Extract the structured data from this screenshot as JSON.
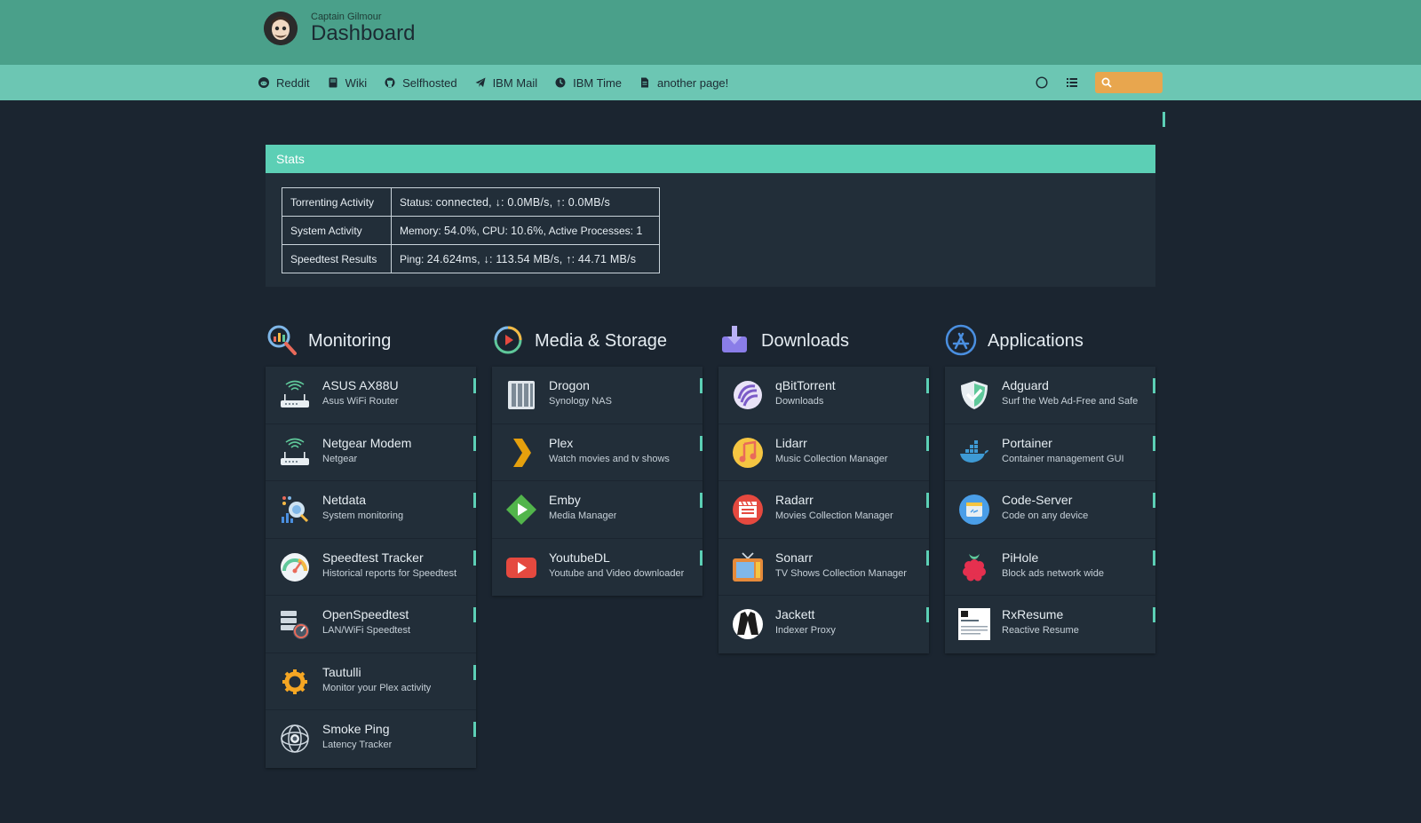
{
  "header": {
    "subtitle": "Captain Gilmour",
    "title": "Dashboard"
  },
  "nav": {
    "links": [
      {
        "label": "Reddit",
        "icon": "reddit-icon"
      },
      {
        "label": "Wiki",
        "icon": "book-icon"
      },
      {
        "label": "Selfhosted",
        "icon": "github-icon"
      },
      {
        "label": "IBM Mail",
        "icon": "paper-plane-icon"
      },
      {
        "label": "IBM Time",
        "icon": "clock-icon"
      },
      {
        "label": "another page!",
        "icon": "file-icon"
      }
    ],
    "search_value": ""
  },
  "stats": {
    "heading": "Stats",
    "rows": [
      {
        "label": "Torrenting Activity",
        "prefix": "Status: ",
        "value": "connected, ↓: 0.0MB/s, ↑: 0.0MB/s",
        "pre2": "",
        "v2": ""
      },
      {
        "label": "System Activity",
        "prefix": "Memory: ",
        "value": "54.0%",
        "pre2": ", CPU: ",
        "v2": "10.6%",
        "pre3": ", Active Processes: ",
        "v3": "1"
      },
      {
        "label": "Speedtest Results",
        "prefix": "Ping: ",
        "value": "24.624ms, ↓: 113.54 MB/s, ↑: 44.71 MB/s"
      }
    ]
  },
  "groups": [
    {
      "title": "Monitoring",
      "icon": "magnifier-chart-icon",
      "items": [
        {
          "name": "ASUS AX88U",
          "desc": "Asus WiFi Router",
          "icon": "router-icon"
        },
        {
          "name": "Netgear Modem",
          "desc": "Netgear",
          "icon": "router-icon"
        },
        {
          "name": "Netdata",
          "desc": "System monitoring",
          "icon": "netdata-icon"
        },
        {
          "name": "Speedtest Tracker",
          "desc": "Historical reports for Speedtest",
          "icon": "gauge-icon"
        },
        {
          "name": "OpenSpeedtest",
          "desc": "LAN/WiFi Speedtest",
          "icon": "server-gauge-icon"
        },
        {
          "name": "Tautulli",
          "desc": "Monitor your Plex activity",
          "icon": "gear-icon"
        },
        {
          "name": "Smoke Ping",
          "desc": "Latency Tracker",
          "icon": "radar-icon"
        }
      ]
    },
    {
      "title": "Media & Storage",
      "icon": "play-ring-icon",
      "items": [
        {
          "name": "Drogon",
          "desc": "Synology NAS",
          "icon": "nas-icon"
        },
        {
          "name": "Plex",
          "desc": "Watch movies and tv shows",
          "icon": "plex-chevron-icon"
        },
        {
          "name": "Emby",
          "desc": "Media Manager",
          "icon": "emby-icon"
        },
        {
          "name": "YoutubeDL",
          "desc": "Youtube and Video downloader",
          "icon": "youtube-icon"
        }
      ]
    },
    {
      "title": "Downloads",
      "icon": "download-tray-icon",
      "items": [
        {
          "name": "qBitTorrent",
          "desc": "Downloads",
          "icon": "qbittorrent-icon"
        },
        {
          "name": "Lidarr",
          "desc": "Music Collection Manager",
          "icon": "music-note-icon"
        },
        {
          "name": "Radarr",
          "desc": "Movies Collection Manager",
          "icon": "clapperboard-icon"
        },
        {
          "name": "Sonarr",
          "desc": "TV Shows Collection Manager",
          "icon": "tv-icon"
        },
        {
          "name": "Jackett",
          "desc": "Indexer Proxy",
          "icon": "jacket-icon"
        }
      ]
    },
    {
      "title": "Applications",
      "icon": "app-store-icon",
      "items": [
        {
          "name": "Adguard",
          "desc": "Surf the Web Ad-Free and Safe",
          "icon": "shield-check-icon"
        },
        {
          "name": "Portainer",
          "desc": "Container management GUI",
          "icon": "docker-whale-icon"
        },
        {
          "name": "Code-Server",
          "desc": "Code on any device",
          "icon": "code-server-icon"
        },
        {
          "name": "PiHole",
          "desc": "Block ads network wide",
          "icon": "raspberry-icon"
        },
        {
          "name": "RxResume",
          "desc": "Reactive Resume",
          "icon": "resume-icon"
        }
      ]
    }
  ],
  "colors": {
    "header": "#4aa08a",
    "navbar": "#6cc6b3",
    "accent": "#5ccfb5",
    "search": "#e8a64e",
    "background": "#1b2530",
    "card": "#222e39"
  }
}
